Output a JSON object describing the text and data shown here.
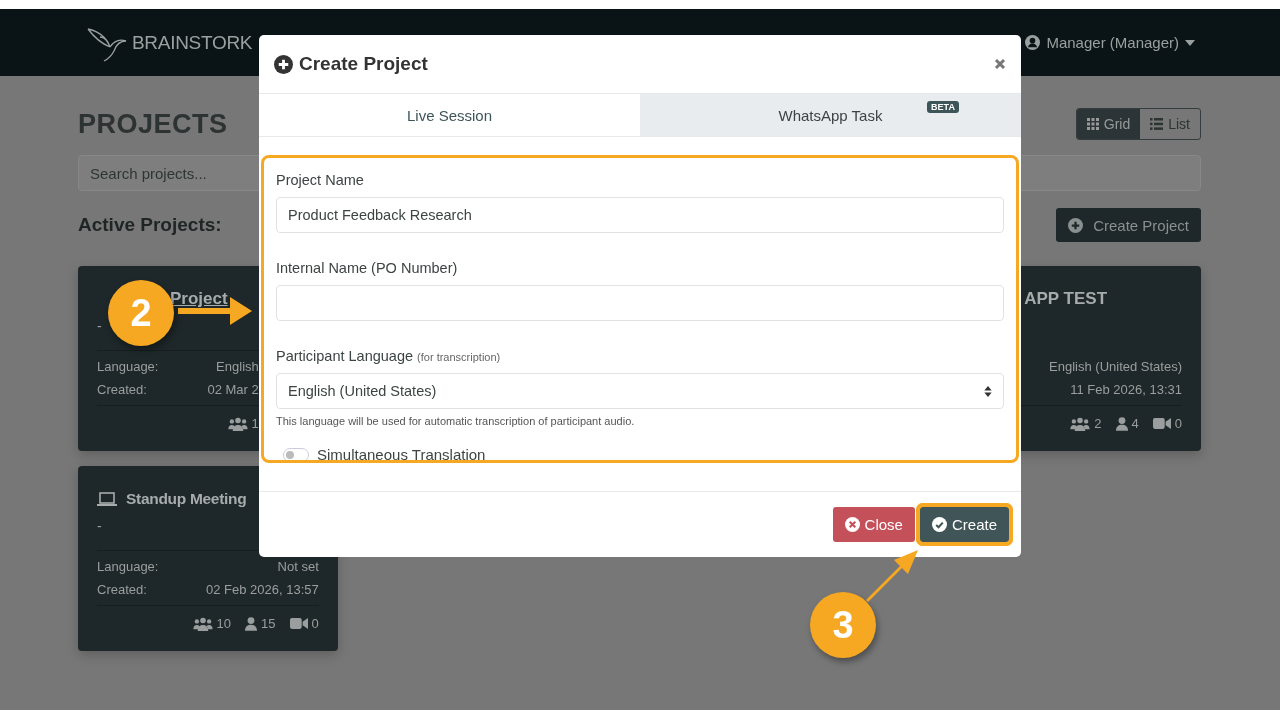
{
  "navbar": {
    "brand": "BRAINSTORK",
    "user_menu": "Manager (Manager)"
  },
  "page": {
    "title": "PROJECTS",
    "view_toggle": [
      {
        "label": "Grid",
        "selected": true
      },
      {
        "label": "List",
        "selected": false
      }
    ],
    "search": {
      "placeholder": "Search projects..."
    },
    "section_title": "Active Projects:",
    "create_button": "Create Project"
  },
  "projects": [
    {
      "title": "Project",
      "subtitle": "-",
      "rows": [
        {
          "label": "Language:",
          "value": "English"
        },
        {
          "label": "Created:",
          "value": "02 Mar 2"
        }
      ],
      "stats": [
        {
          "kind": "groups",
          "value": "1"
        }
      ]
    },
    {
      "title": "APP TEST",
      "rows": [
        {
          "value": "English (United States)"
        },
        {
          "value": "11 Feb 2026, 13:31"
        }
      ],
      "stats": [
        {
          "kind": "groups",
          "value": "2"
        },
        {
          "kind": "participants",
          "value": "4"
        },
        {
          "kind": "videos",
          "value": "0"
        }
      ]
    },
    {
      "title": "Standup Meeting",
      "subtitle": "-",
      "rows": [
        {
          "label": "Language:",
          "value": "Not set"
        },
        {
          "label": "Created:",
          "value": "02 Feb 2026, 13:57"
        }
      ],
      "stats": [
        {
          "kind": "groups",
          "value": "10"
        },
        {
          "kind": "participants",
          "value": "15"
        },
        {
          "kind": "videos",
          "value": "0"
        }
      ]
    }
  ],
  "modal": {
    "title": "Create Project",
    "tabs": [
      {
        "label": "Live Session",
        "selected": true
      },
      {
        "label": "WhatsApp Task",
        "selected": false,
        "badge": "BETA"
      }
    ],
    "highlighted": true,
    "fields": [
      {
        "kind": "text",
        "label": "Project Name",
        "value": "Product Feedback Research"
      },
      {
        "kind": "text",
        "label": "Internal Name (PO Number)"
      },
      {
        "kind": "select",
        "label": "Participant Language",
        "note": "(for transcription)",
        "value": "English (United States)",
        "help": "This language will be used for automatic transcription of participant audio."
      },
      {
        "kind": "toggle",
        "label": "Simultaneous Translation",
        "on": false
      }
    ],
    "buttons": [
      {
        "kind": "close",
        "label": "Close",
        "highlighted": false
      },
      {
        "kind": "create",
        "label": "Create",
        "highlighted": true
      }
    ]
  },
  "annotations": [
    {
      "kind": "step-right",
      "number": "2"
    },
    {
      "kind": "step-up",
      "number": "3"
    }
  ]
}
